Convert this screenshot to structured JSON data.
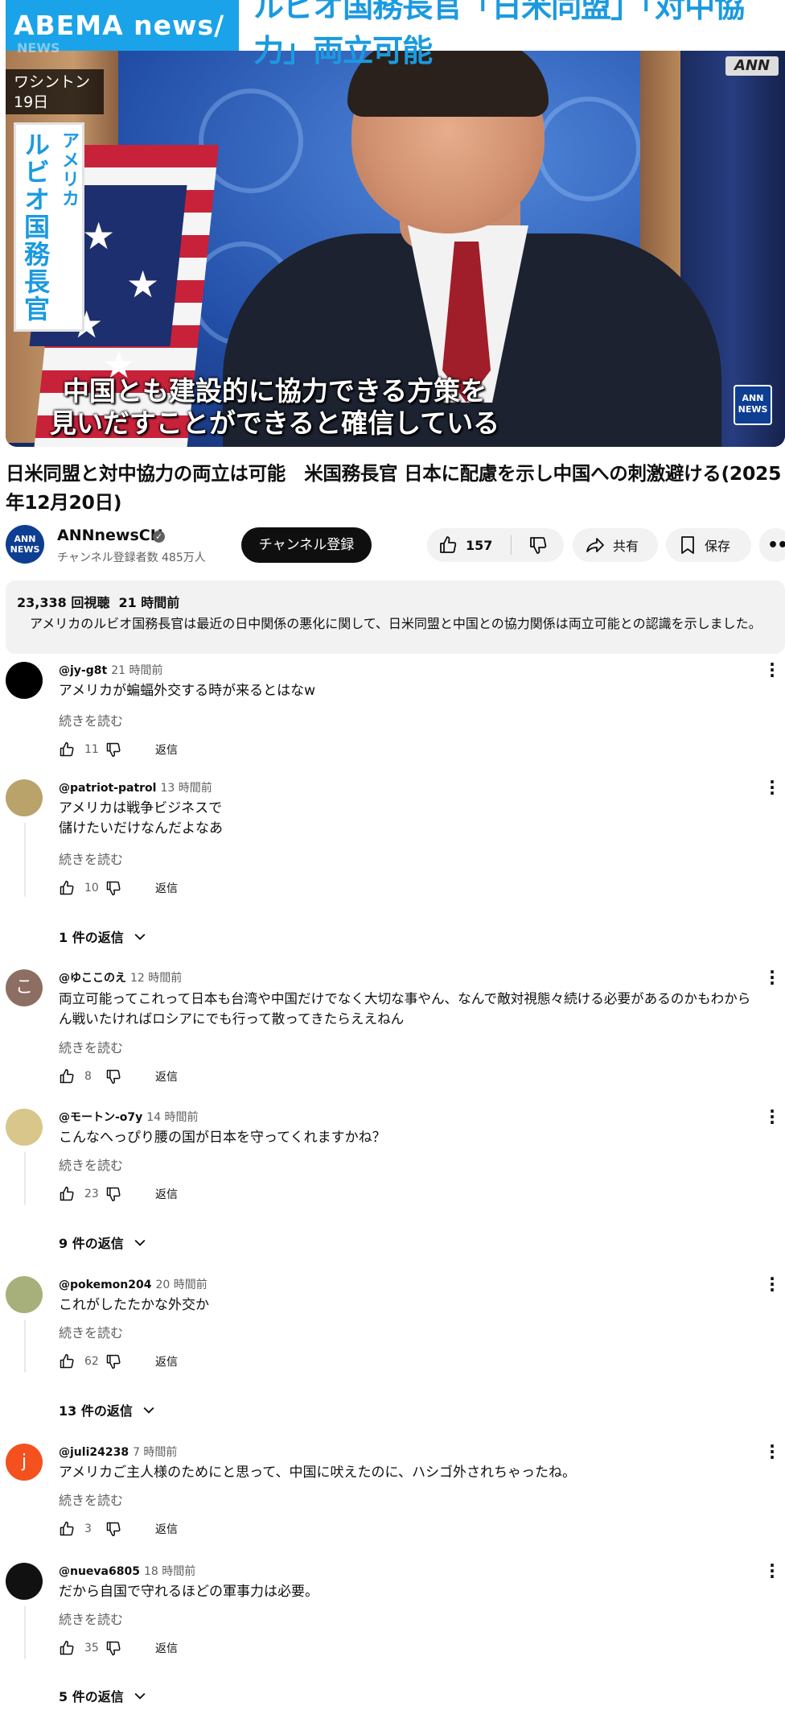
{
  "video": {
    "brand": "ABEMA news/",
    "headline": "ルビオ国務長官「日米同盟」「対中協力」両立可能",
    "location_line1": "ワシントン",
    "location_line2": "19日",
    "corner_logo": "ANN",
    "banner_line1": "アメリカ",
    "banner_line2": "ルビオ国務長官",
    "subtitle_line1": "中国とも建設的に協力できる方策を",
    "subtitle_line2": "見いだすことができると確信している",
    "badge_line1": "ANN",
    "badge_line2": "NEWS"
  },
  "title": "日米同盟と対中協力の両立は可能　米国務長官 日本に配慮を示し中国への刺激避ける(2025年12月20日)",
  "channel": {
    "avatar_line1": "ANN",
    "avatar_line2": "NEWS",
    "name": "ANNnewsCH",
    "subscribers": "チャンネル登録者数 485万人",
    "subscribe_label": "チャンネル登録"
  },
  "actions": {
    "likes": "157",
    "share_label": "共有",
    "save_label": "保存"
  },
  "description": {
    "views": "23,338 回視聴",
    "time": "21 時間前",
    "text": "アメリカのルビオ国務長官は最近の日中関係の悪化に関して、日米同盟と中国との協力関係は両立可能との認識を示しました。"
  },
  "comment_ui": {
    "read_more": "続きを読む",
    "reply_label": "返信"
  },
  "comments": [
    {
      "author": "@jy-g8t",
      "time": "21 時間前",
      "line1": "アメリカが蝙蝠外交する時が来るとはなw",
      "line2": "",
      "likes": "11",
      "replies": ""
    },
    {
      "author": "@patriot-patrol",
      "time": "13 時間前",
      "line1": "アメリカは戦争ビジネスで",
      "line2": "儲けたいだけなんだよなあ",
      "likes": "10",
      "replies": "1 件の返信"
    },
    {
      "author": "@ゆここのえ",
      "time": "12 時間前",
      "line1": "両立可能ってこれって日本も台湾や中国だけでなく大切な事やん、なんで敵対視態々続ける必要があるのかもわから",
      "line2": "ん戦いたければロシアにでも行って散ってきたらええねん",
      "likes": "8",
      "replies": "",
      "avatar_letter": "こ"
    },
    {
      "author": "@モートン-o7y",
      "time": "14 時間前",
      "line1": "こんなへっぴり腰の国が日本を守ってくれますかね？",
      "line2": "",
      "likes": "23",
      "replies": "9 件の返信"
    },
    {
      "author": "@pokemon204",
      "time": "20 時間前",
      "line1": "これがしたたかな外交か",
      "line2": "",
      "likes": "62",
      "replies": "13 件の返信"
    },
    {
      "author": "@juli24238",
      "time": "7 時間前",
      "line1": "アメリカご主人様のためにと思って、中国に吠えたのに、ハシゴ外されちゃったね。",
      "line2": "",
      "likes": "3",
      "replies": "",
      "avatar_letter": "j"
    },
    {
      "author": "@nueva6805",
      "time": "18 時間前",
      "line1": "だから自国で守れるほどの軍事力は必要。",
      "line2": "",
      "likes": "35",
      "replies": "5 件の返信"
    }
  ],
  "colors": {
    "brand_blue": "#1aa3e8",
    "headline_blue": "#1b9ae0",
    "subscribe_black": "#0f0f0f",
    "pill_gray": "#f2f2f2",
    "meta_gray": "#606060"
  },
  "icons": [
    "thumbs-up-icon",
    "thumbs-down-icon",
    "share-icon",
    "bookmark-icon",
    "more-icon",
    "chevron-down-icon",
    "verified-icon"
  ]
}
